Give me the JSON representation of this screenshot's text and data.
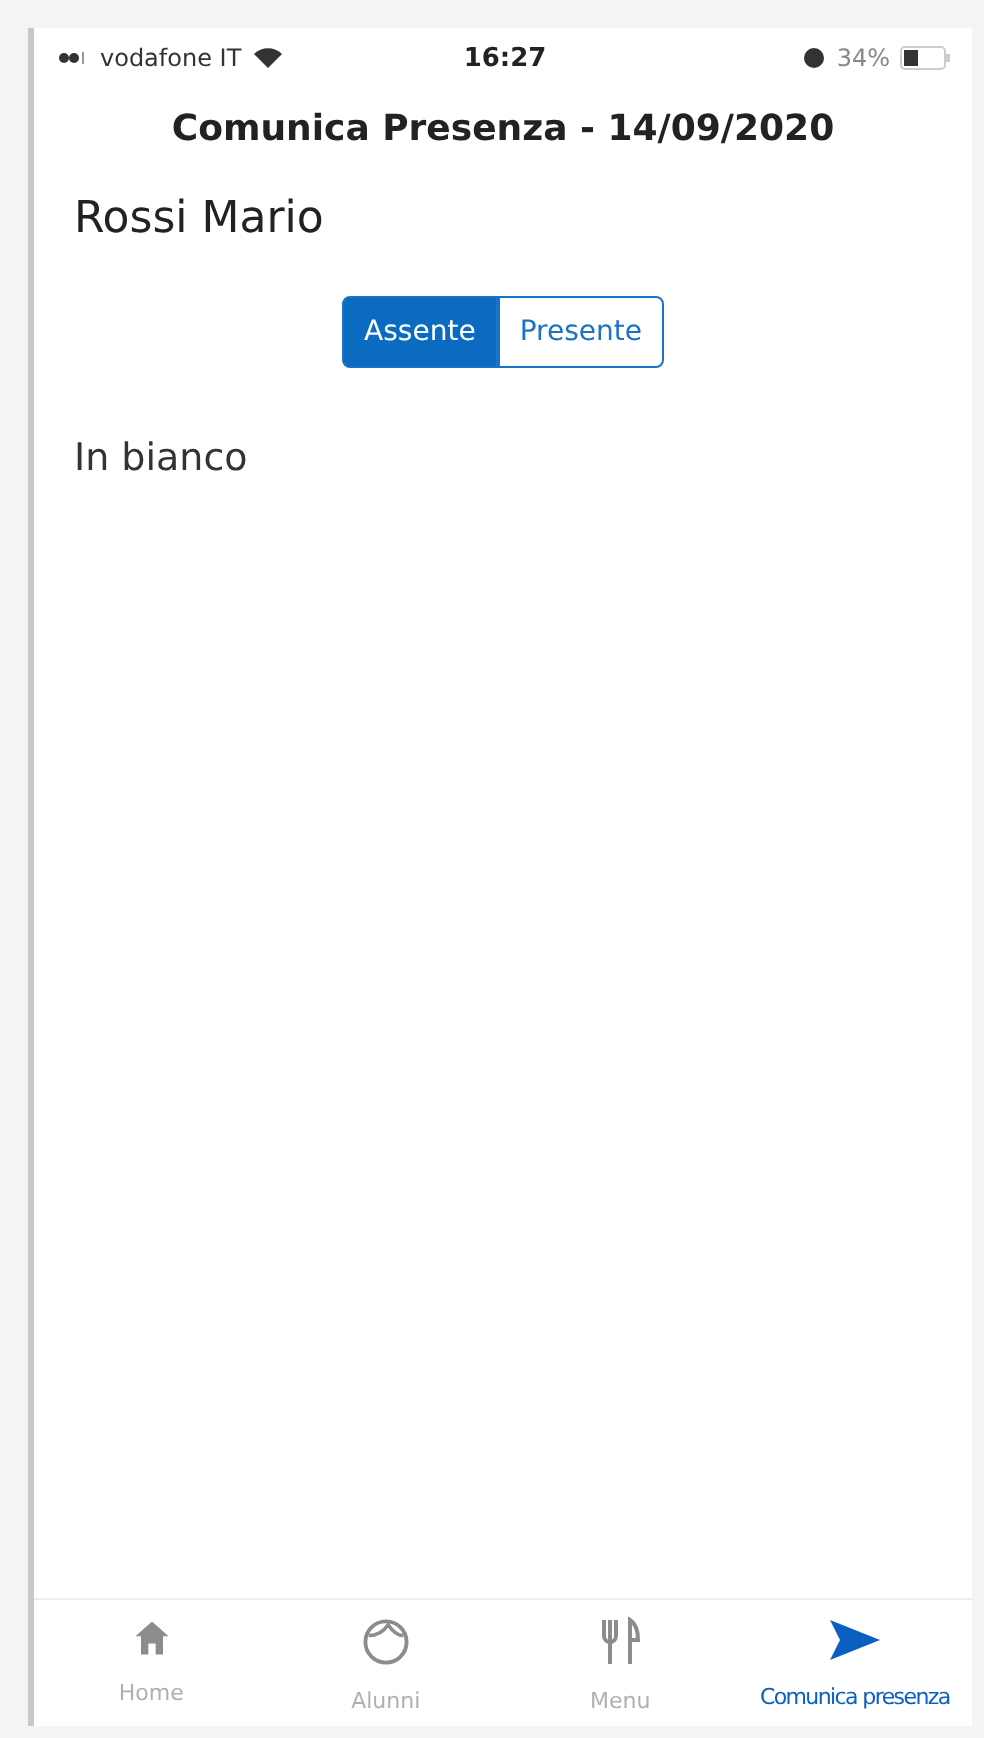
{
  "status_bar": {
    "carrier": "vodafone IT",
    "time": "16:27",
    "battery": "34%"
  },
  "header": {
    "title": "Comunica Presenza - 14/09/2020"
  },
  "student": {
    "name": "Rossi Mario"
  },
  "segments": [
    {
      "label": "Assente",
      "selected": true
    },
    {
      "label": "Presente",
      "selected": false
    }
  ],
  "note": "In bianco",
  "tab_bar": [
    {
      "kind": "home",
      "label": "Home",
      "selected": false
    },
    {
      "kind": "face",
      "label": "Alunni",
      "selected": false
    },
    {
      "kind": "cutlery",
      "label": "Menu",
      "selected": false
    },
    {
      "kind": "send",
      "label": "Comunica presenza",
      "selected": true
    }
  ]
}
